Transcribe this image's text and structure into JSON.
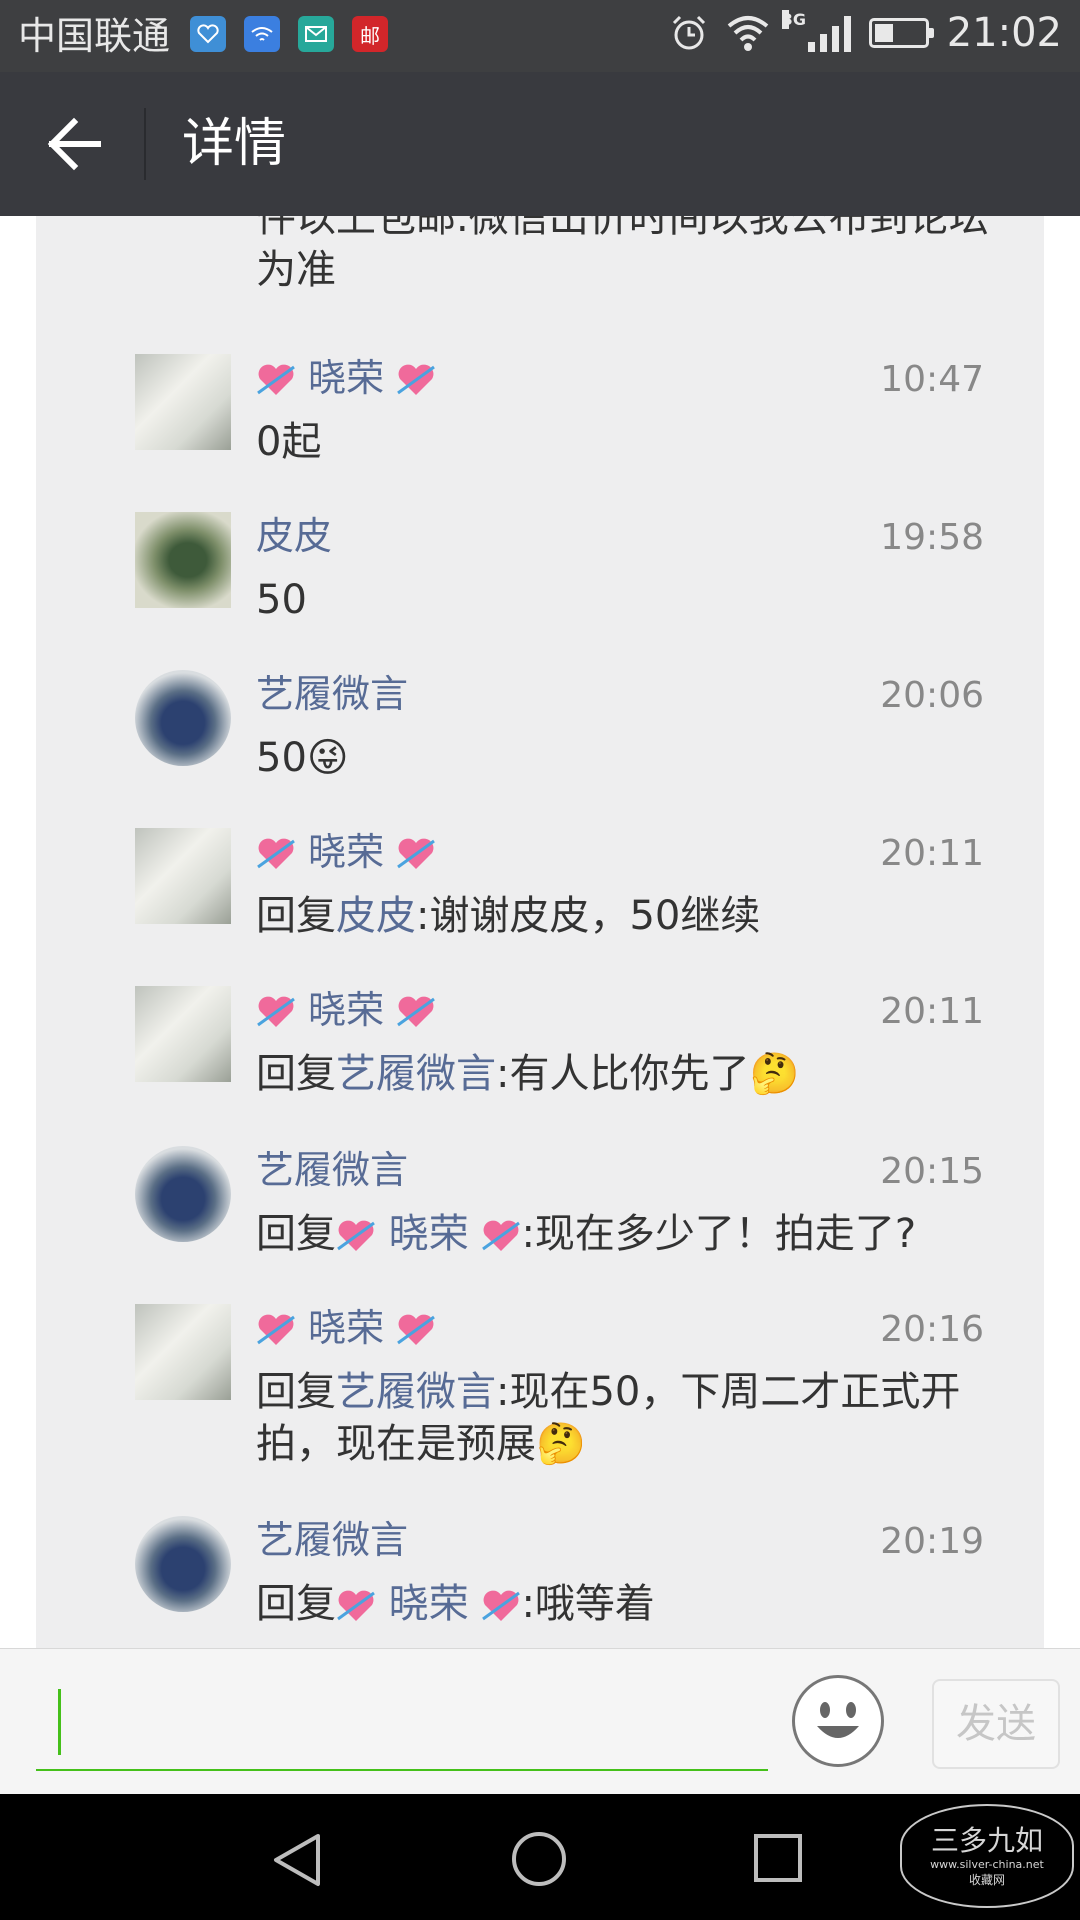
{
  "status_bar": {
    "carrier": "中国联通",
    "app_icons": [
      "health-icon",
      "wifi-app-icon",
      "mail-icon",
      "post-icon"
    ],
    "post_glyph": "邮",
    "network": "3G",
    "time": "21:02"
  },
  "header": {
    "title": "详情"
  },
  "top_text": "件以上包邮.微信出价时间以我公布到论坛为准",
  "comments": [
    {
      "name": "晓荣",
      "time": "10:47",
      "text": "0起"
    },
    {
      "name": "皮皮",
      "time": "19:58",
      "text": "50"
    },
    {
      "name": "艺履微言",
      "time": "20:06",
      "text": "50",
      "emoji": "😜"
    },
    {
      "name": "晓荣",
      "time": "20:11",
      "reply_prefix": "回复",
      "reply_to": "皮皮",
      "text": ":谢谢皮皮，50继续"
    },
    {
      "name": "晓荣",
      "time": "20:11",
      "reply_prefix": "回复",
      "reply_to": "艺履微言",
      "text": ":有人比你先了",
      "emoji": "🤔"
    },
    {
      "name": "艺履微言",
      "time": "20:15",
      "reply_prefix": "回复",
      "reply_to": "晓荣",
      "text": ":现在多少了！拍走了?"
    },
    {
      "name": "晓荣",
      "time": "20:16",
      "reply_prefix": "回复",
      "reply_to": "艺履微言",
      "text": ":现在50，下周二才正式开拍，现在是预展",
      "emoji": "🤔"
    },
    {
      "name": "艺履微言",
      "time": "20:19",
      "reply_prefix": "回复",
      "reply_to": "晓荣",
      "text": ":哦等着"
    }
  ],
  "input": {
    "value": "",
    "send_label": "发送"
  },
  "watermark": {
    "main": "三多九如",
    "url": "www.silver-china.net",
    "sub": "收藏网"
  },
  "colors": {
    "status_bar": "#3e3f41",
    "title_bar": "#393a3f",
    "panel": "#eeeeef",
    "name_link": "#576b95",
    "input_accent": "#45c01a"
  }
}
